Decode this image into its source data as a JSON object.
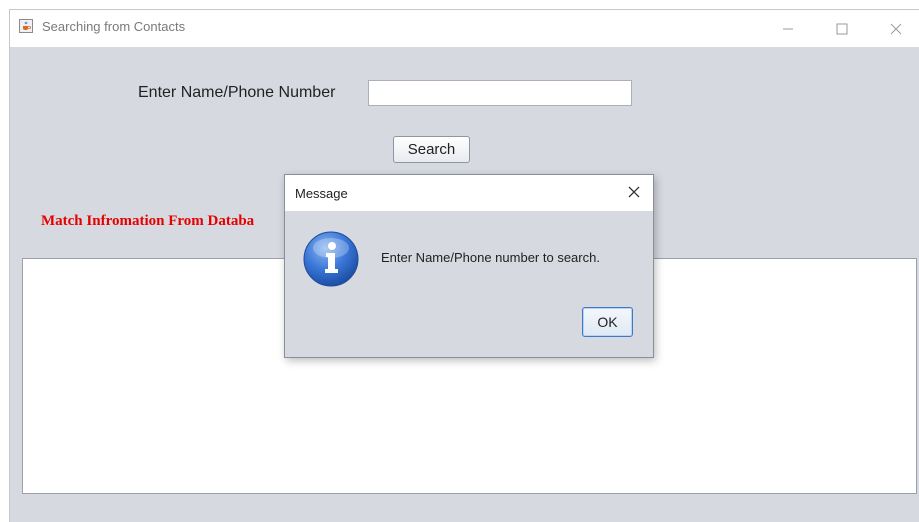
{
  "window": {
    "title": "Searching from Contacts",
    "icons": {
      "app": "java-cup-icon",
      "minimize": "minimize-icon",
      "maximize": "maximize-icon",
      "close": "close-icon"
    }
  },
  "form": {
    "label": "Enter Name/Phone Number",
    "input_value": "",
    "search_label": "Search"
  },
  "results": {
    "heading": "Match Infromation From Databa"
  },
  "dialog": {
    "title": "Message",
    "message": "Enter Name/Phone number to search.",
    "ok_label": "OK",
    "icon": "info-icon"
  },
  "colors": {
    "window_bg": "#d6d9df",
    "heading_red": "#e60000",
    "info_blue": "#2f6fcf"
  }
}
